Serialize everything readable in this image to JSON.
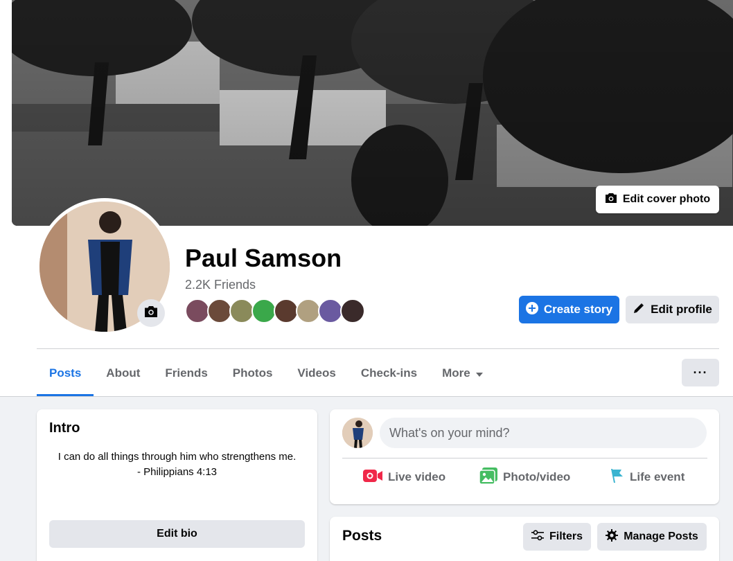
{
  "profile": {
    "name": "Paul Samson",
    "friends_count": "2.2K Friends"
  },
  "cover": {
    "edit_cover_label": "Edit cover photo"
  },
  "actions": {
    "create_story_label": "Create story",
    "edit_profile_label": "Edit profile"
  },
  "tabs": [
    {
      "label": "Posts",
      "active": true
    },
    {
      "label": "About"
    },
    {
      "label": "Friends"
    },
    {
      "label": "Photos"
    },
    {
      "label": "Videos"
    },
    {
      "label": "Check-ins"
    },
    {
      "label": "More"
    }
  ],
  "more_menu_label": "···",
  "intro": {
    "title": "Intro",
    "bio_line1": "I can do all things through him who strengthens me.",
    "bio_line2": "- Philippians 4:13",
    "edit_bio_label": "Edit bio"
  },
  "composer": {
    "placeholder": "What's on your mind?",
    "live_video_label": "Live video",
    "photo_video_label": "Photo/video",
    "life_event_label": "Life event"
  },
  "posts": {
    "title": "Posts",
    "filters_label": "Filters",
    "manage_posts_label": "Manage Posts"
  },
  "colors": {
    "accent": "#1b74e4",
    "page_bg": "#f0f2f5",
    "button_gray": "#e4e6eb",
    "live_red": "#f02849",
    "photo_green": "#45bd62",
    "event_teal": "#3ab4d0"
  },
  "friend_avatar_colors": [
    "#7a4b5e",
    "#6b4a3a",
    "#8a8a5a",
    "#3aa84a",
    "#5a3a2e",
    "#b0a080",
    "#6a5aa0",
    "#3a2a2a"
  ]
}
